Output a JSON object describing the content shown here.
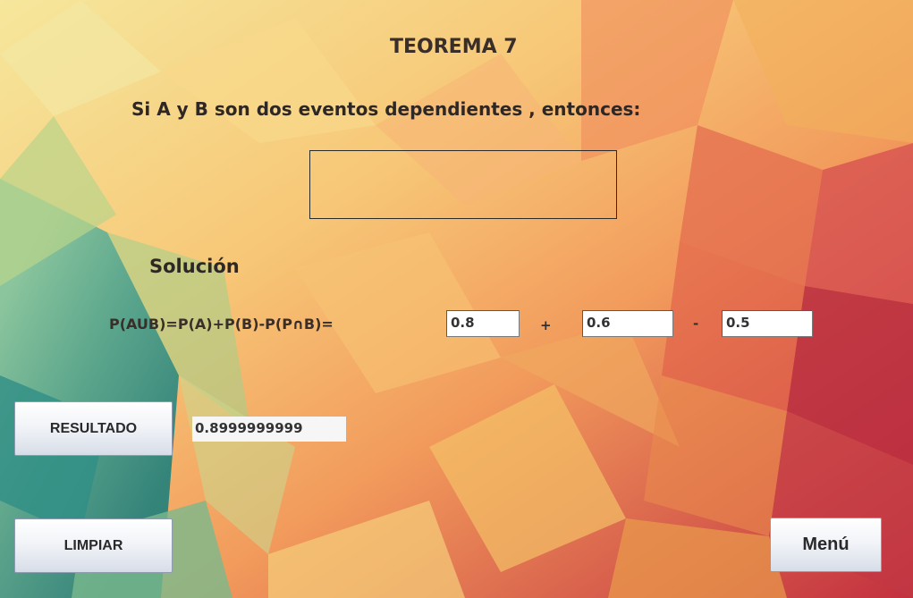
{
  "header": {
    "title": "TEOREMA 7",
    "statement": "Si A y B son dos eventos dependientes , entonces:"
  },
  "solution": {
    "heading": "Solución",
    "formula": "P(AUB)=P(A)+P(B)-P(P∩B)=",
    "field_a": "0.8",
    "op_plus": "+",
    "field_b": "0.6",
    "op_minus": "-",
    "field_ab": "0.5"
  },
  "actions": {
    "resultado_label": "RESULTADO",
    "result_value": "0.8999999999",
    "limpiar_label": "LIMPIAR",
    "menu_label": "Menú"
  }
}
